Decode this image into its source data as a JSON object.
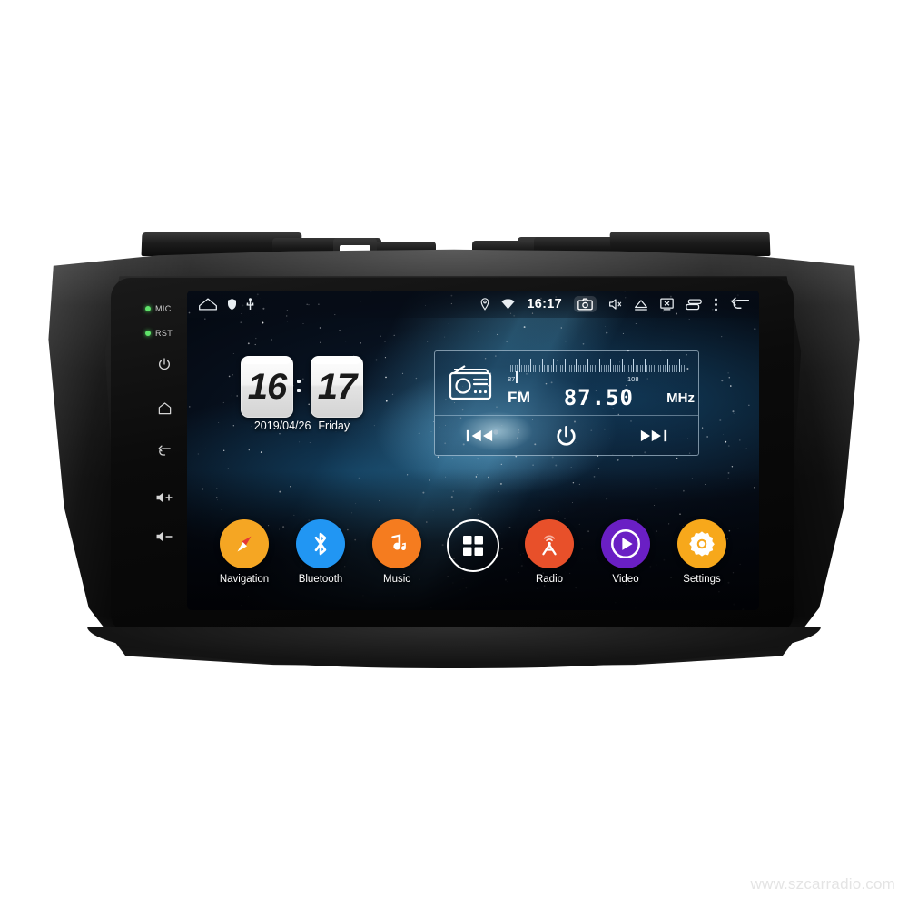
{
  "product": {
    "type": "car-stereo-head-unit",
    "watermark": "www.szcarradio.com"
  },
  "bezel_keys": [
    {
      "name": "mic",
      "label": "MIC",
      "led": true,
      "icon": "led-indicator"
    },
    {
      "name": "reset",
      "label": "RST",
      "led": true,
      "icon": "led-indicator"
    },
    {
      "name": "power",
      "label": "",
      "led": false,
      "icon": "power-icon"
    },
    {
      "name": "home",
      "label": "",
      "led": false,
      "icon": "home-icon"
    },
    {
      "name": "back",
      "label": "",
      "led": false,
      "icon": "back-icon"
    },
    {
      "name": "volume-up",
      "label": "",
      "led": false,
      "icon": "volume-up-icon"
    },
    {
      "name": "volume-down",
      "label": "",
      "led": false,
      "icon": "volume-down-icon"
    }
  ],
  "statusbar": {
    "left_icons": [
      "home-icon",
      "shield-icon",
      "usb-icon"
    ],
    "time": "16:17",
    "right_icons": [
      "location-icon",
      "wifi-icon",
      "camera-icon",
      "mute-icon",
      "eject-icon",
      "screen-off-icon",
      "recent-apps-icon",
      "more-options-icon",
      "back-arrow-icon"
    ],
    "camera_highlighted": true
  },
  "clock_widget": {
    "hours": "16",
    "minutes": "17",
    "date": "2019/04/26",
    "weekday": "Friday"
  },
  "radio_widget": {
    "icon": "radio-icon",
    "band": "FM",
    "frequency": "87.50",
    "unit": "MHz",
    "scale_min": "87",
    "scale_max": "108",
    "controls": [
      "previous-station-button",
      "power-button",
      "next-station-button"
    ]
  },
  "apps": [
    {
      "label": "Navigation",
      "icon": "compass-icon",
      "color": "#F5A623"
    },
    {
      "label": "Bluetooth",
      "icon": "bluetooth-icon",
      "color": "#2196F3"
    },
    {
      "label": "Music",
      "icon": "music-note-icon",
      "color": "#F57C1F"
    },
    {
      "label": "",
      "icon": "apps-grid-icon",
      "color": "transparent"
    },
    {
      "label": "Radio",
      "icon": "radio-tower-icon",
      "color": "#E8502A"
    },
    {
      "label": "Video",
      "icon": "play-icon",
      "color": "#6A1FC4"
    },
    {
      "label": "Settings",
      "icon": "gear-icon",
      "color": "#F7A81B"
    }
  ],
  "colors": {
    "accent_orange": "#F5A623",
    "bluetooth_blue": "#2196F3",
    "music_orange": "#F57C1F",
    "radio_red": "#E8502A",
    "video_purple": "#6A1FC4",
    "settings_orange": "#F7A81B",
    "led_green": "#5FE36A"
  }
}
